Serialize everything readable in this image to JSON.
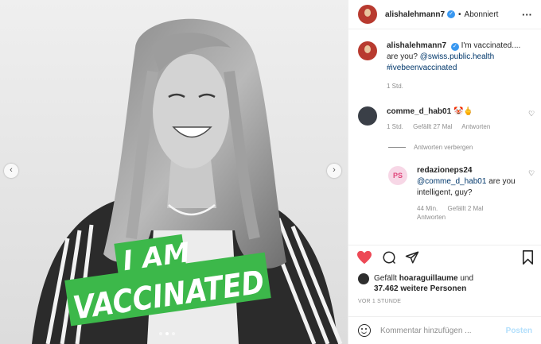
{
  "post": {
    "author": "alishalehmann7",
    "separator": "•",
    "follow_state": "Abonniert",
    "more_icon": "more-horizontal-icon",
    "image_text_line1": "I AM",
    "image_text_line2": "VACCINATED",
    "slide_count": 3,
    "active_slide": 1
  },
  "caption": {
    "user": "alishalehmann7",
    "text": "I'm vaccinated.... are you? ",
    "mention": "@swiss.public.health",
    "hashtag": "#ivebeenvaccinated",
    "time": "1 Std."
  },
  "comments": [
    {
      "user": "comme_d_hab01",
      "text": "🤡🖕",
      "time": "1 Std.",
      "likes": "Gefällt 27 Mal",
      "reply": "Antworten"
    }
  ],
  "replies_toggle": "Antworten verbergen",
  "replies": [
    {
      "user": "redazioneps24",
      "avatar_text": "PS",
      "mention": "@comme_d_hab01",
      "text": " are you intelligent, guy?",
      "time": "44 Min.",
      "likes": "Gefällt 2 Mal",
      "reply": "Antworten"
    }
  ],
  "likes": {
    "prefix": "Gefällt ",
    "user": "hoaraguillaume",
    "middle": " und",
    "count_text": "37.462 weitere Personen"
  },
  "timestamp": "VOR 1 STUNDE",
  "add_comment": {
    "placeholder": "Kommentar hinzufügen ...",
    "post_label": "Posten"
  },
  "colors": {
    "accent_green": "#3cb84a",
    "like_red": "#ed4956",
    "verified_blue": "#3897f0",
    "link_blue": "#00376b"
  }
}
